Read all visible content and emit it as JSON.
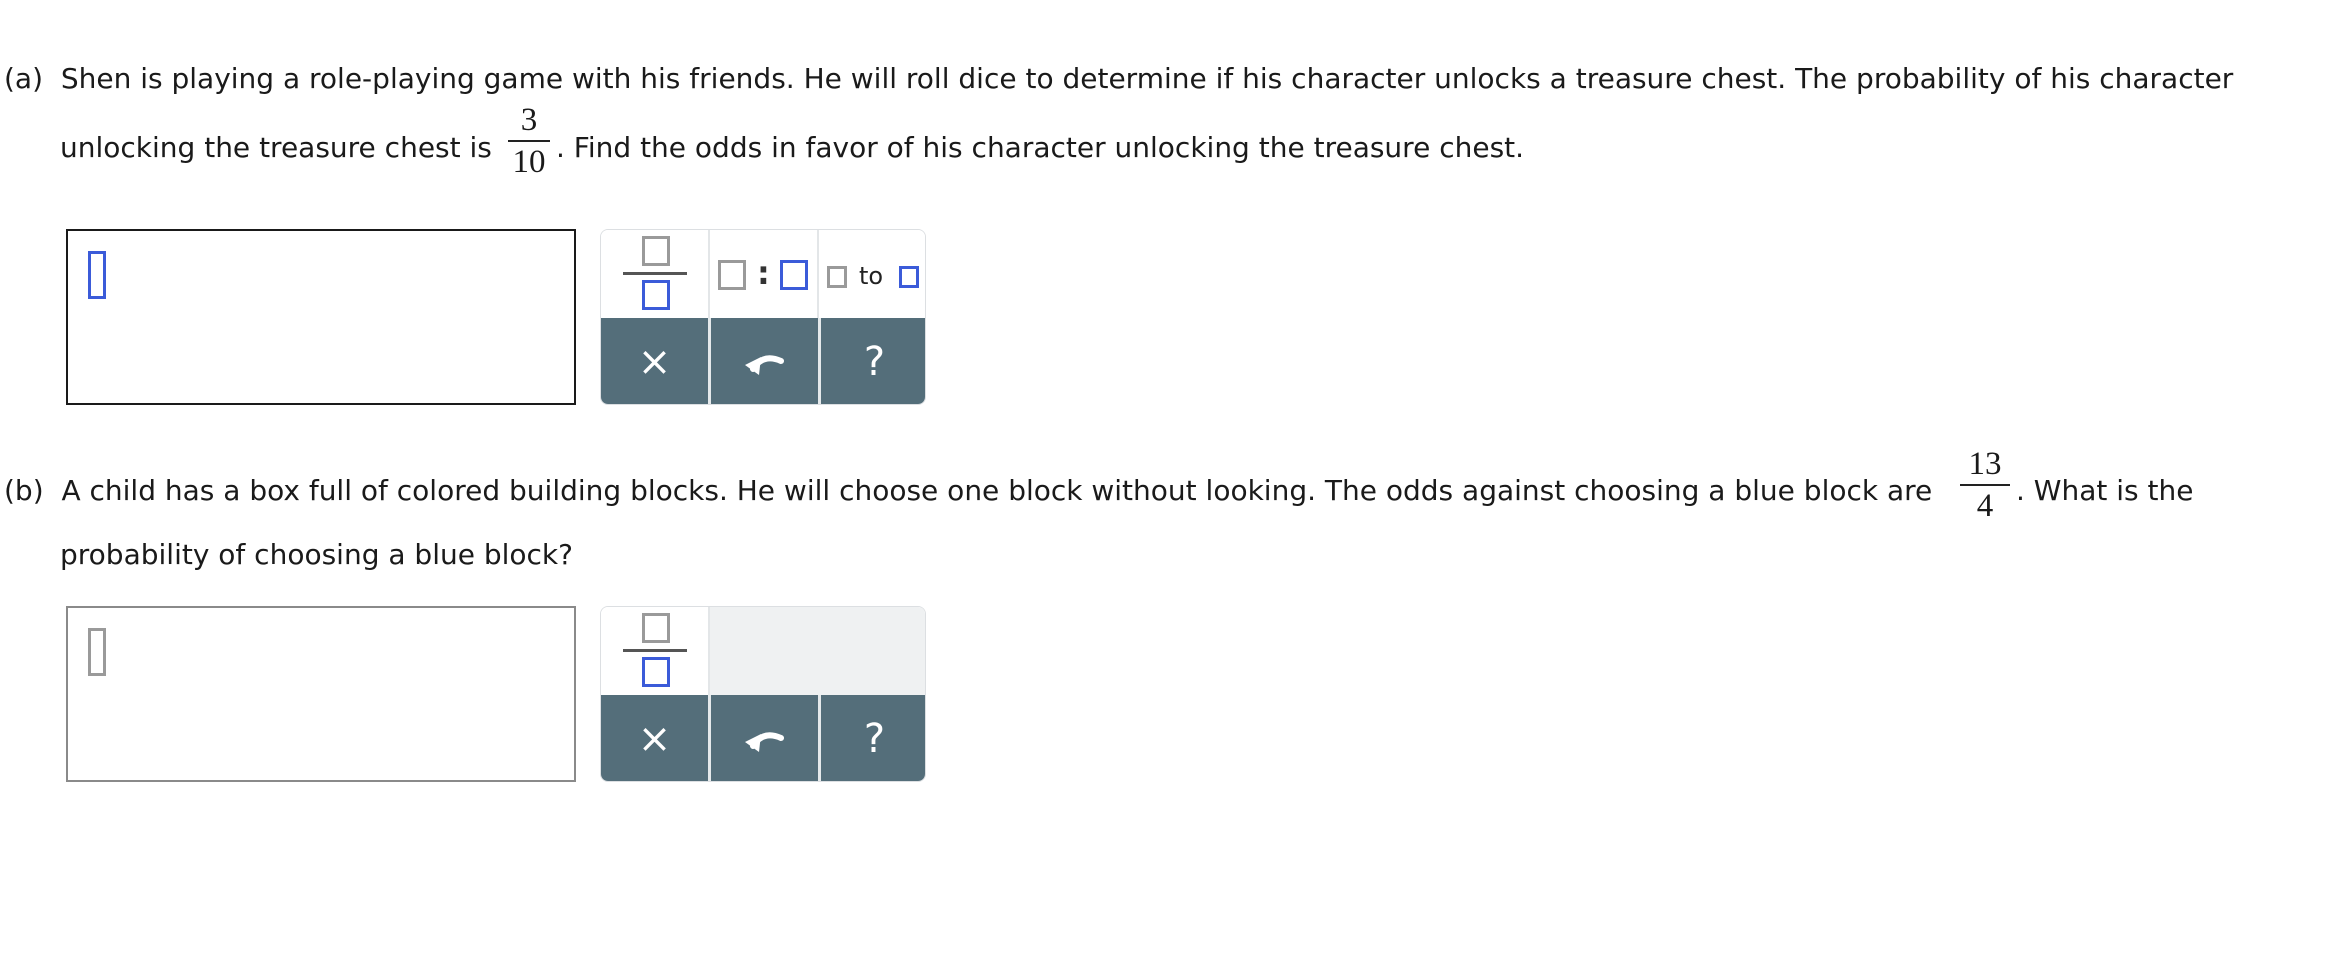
{
  "part_a": {
    "label": "(a)",
    "line1": "Shen is playing a role-playing game with his friends. He will roll dice to determine if his character unlocks a treasure chest. The probability of his character",
    "line2_before": "unlocking the treasure chest is",
    "frac_num": "3",
    "frac_den": "10",
    "line2_after": ". Find the odds in favor of his character unlocking the treasure chest.",
    "palette": {
      "buttons": [
        "fraction-template",
        "ratio-colon-template",
        "ratio-to-template"
      ],
      "to_label": "to",
      "clear": "×",
      "undo": "↶",
      "help": "?"
    }
  },
  "part_b": {
    "label": "(b)",
    "line1_before": "A child has a box full of colored building blocks. He will choose one block without looking. The odds against choosing a blue block are",
    "frac_num": "13",
    "frac_den": "4",
    "line1_after": ". What is the",
    "line2": "probability of choosing a blue block?",
    "palette": {
      "buttons": [
        "fraction-template"
      ],
      "clear": "×",
      "undo": "↶",
      "help": "?"
    }
  },
  "colors": {
    "toolbar": "#546e7a",
    "accent_blue": "#3b5bd9"
  }
}
